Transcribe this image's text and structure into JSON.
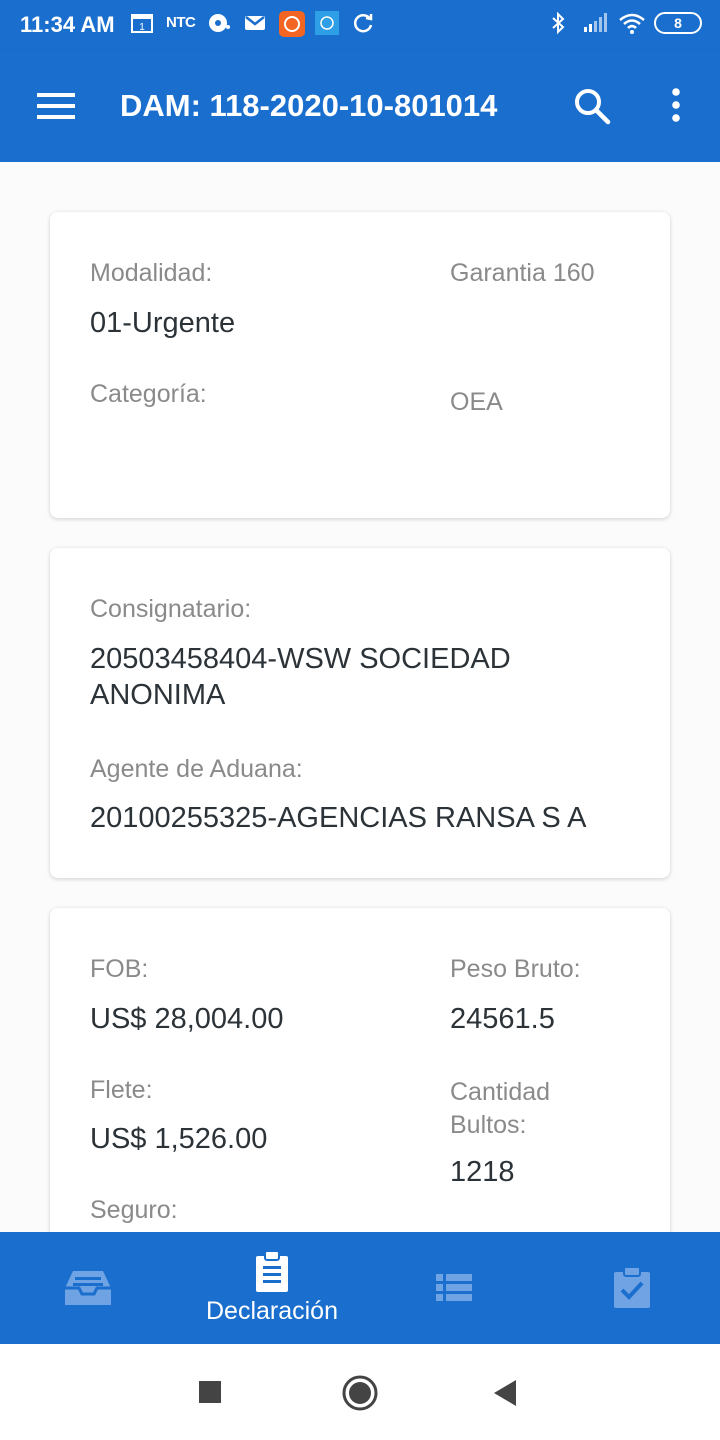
{
  "status_bar": {
    "time": "11:34 AM",
    "carrier_badge": "NTC",
    "battery": "8",
    "icons_left": [
      "calendar-icon",
      "nike-ntc-icon",
      "drive-icon",
      "gmail-icon",
      "app-orange-icon",
      "app-blue-icon",
      "sync-icon"
    ],
    "icons_right": [
      "bluetooth-icon",
      "signal-icon",
      "wifi-icon",
      "battery-icon"
    ]
  },
  "app_bar": {
    "title": "DAM: 118-2020-10-801014",
    "icons": [
      "menu-icon",
      "search-icon",
      "more-vert-icon"
    ]
  },
  "card1": {
    "modalidad_label": "Modalidad:",
    "modalidad_value": "01-Urgente",
    "garantia": "Garantia 160",
    "categoria_label": "Categoría:",
    "oea": "OEA"
  },
  "card2": {
    "consignatario_label": "Consignatario:",
    "consignatario_value": "20503458404-WSW SOCIEDAD ANONIMA",
    "agente_label": "Agente de Aduana:",
    "agente_value": "20100255325-AGENCIAS RANSA S A"
  },
  "card3": {
    "fob_label": "FOB:",
    "fob_value": "US$ 28,004.00",
    "peso_label": "Peso Bruto:",
    "peso_value": "24561.5",
    "flete_label": "Flete:",
    "flete_value": "US$ 1,526.00",
    "bultos_label": "Cantidad Bultos:",
    "bultos_value": "1218",
    "seguro_label": "Seguro:"
  },
  "bottom_nav": {
    "items": [
      {
        "icon": "inbox-icon",
        "label": ""
      },
      {
        "icon": "clipboard-icon",
        "label": "Declaración",
        "active": true
      },
      {
        "icon": "list-icon",
        "label": ""
      },
      {
        "icon": "clipboard-check-icon",
        "label": ""
      }
    ]
  },
  "colors": {
    "primary": "#1a6fce",
    "inactive_icon": "#6fa3e3",
    "label_text": "#8a8a8a",
    "value_text": "#2c3338"
  }
}
